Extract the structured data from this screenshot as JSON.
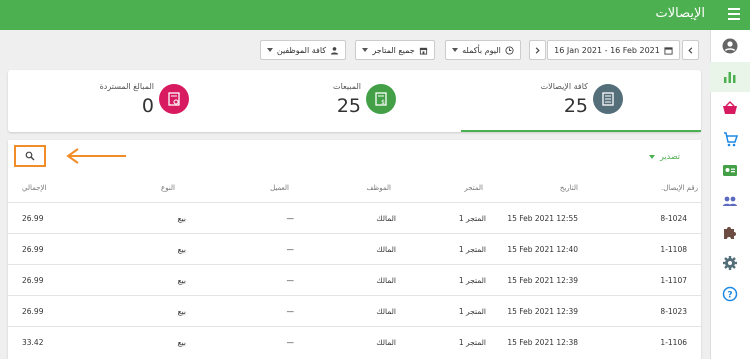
{
  "header": {
    "title": "الإيصالات",
    "menu_icon": "hamburger-icon"
  },
  "colors": {
    "brand": "#4caf50",
    "accent_highlight": "#f28c28",
    "sales_icon_bg": "#43a047",
    "refunds_icon_bg": "#d81b60",
    "receipts_icon_bg": "#546e7a"
  },
  "filters": {
    "date_range": "16 Jan 2021 - 16 Feb 2021",
    "time_period": "اليوم بأكمله",
    "stores": "جميع المتاجر",
    "employees": "كافة الموظفين"
  },
  "summary": {
    "all_receipts": {
      "label": "كافة الإيصالات",
      "value": "25"
    },
    "sales": {
      "label": "المبيعات",
      "value": "25"
    },
    "refunds": {
      "label": "المبالغ المستردة",
      "value": "0"
    }
  },
  "toolbar": {
    "export_label": "تصدير"
  },
  "table": {
    "headers": {
      "receipt_no": "رقم الإيصال.",
      "date": "التاريخ",
      "store": "المتجر",
      "employee": "الموظف",
      "customer": "العميل",
      "type": "النوع",
      "total": "الإجمالي"
    },
    "rows": [
      {
        "receipt_no": "8-1024",
        "date": "15 Feb 2021 12:55",
        "store": "المتجر 1",
        "employee": "المالك",
        "customer": "—",
        "type": "بيع",
        "total": "26.99"
      },
      {
        "receipt_no": "1-1108",
        "date": "15 Feb 2021 12:40",
        "store": "المتجر 1",
        "employee": "المالك",
        "customer": "—",
        "type": "بيع",
        "total": "26.99"
      },
      {
        "receipt_no": "1-1107",
        "date": "15 Feb 2021 12:39",
        "store": "المتجر 1",
        "employee": "المالك",
        "customer": "—",
        "type": "بيع",
        "total": "26.99"
      },
      {
        "receipt_no": "8-1023",
        "date": "15 Feb 2021 12:39",
        "store": "المتجر 1",
        "employee": "المالك",
        "customer": "—",
        "type": "بيع",
        "total": "26.99"
      },
      {
        "receipt_no": "1-1106",
        "date": "15 Feb 2021 12:38",
        "store": "المتجر 1",
        "employee": "المالك",
        "customer": "—",
        "type": "بيع",
        "total": "33.42"
      }
    ]
  }
}
